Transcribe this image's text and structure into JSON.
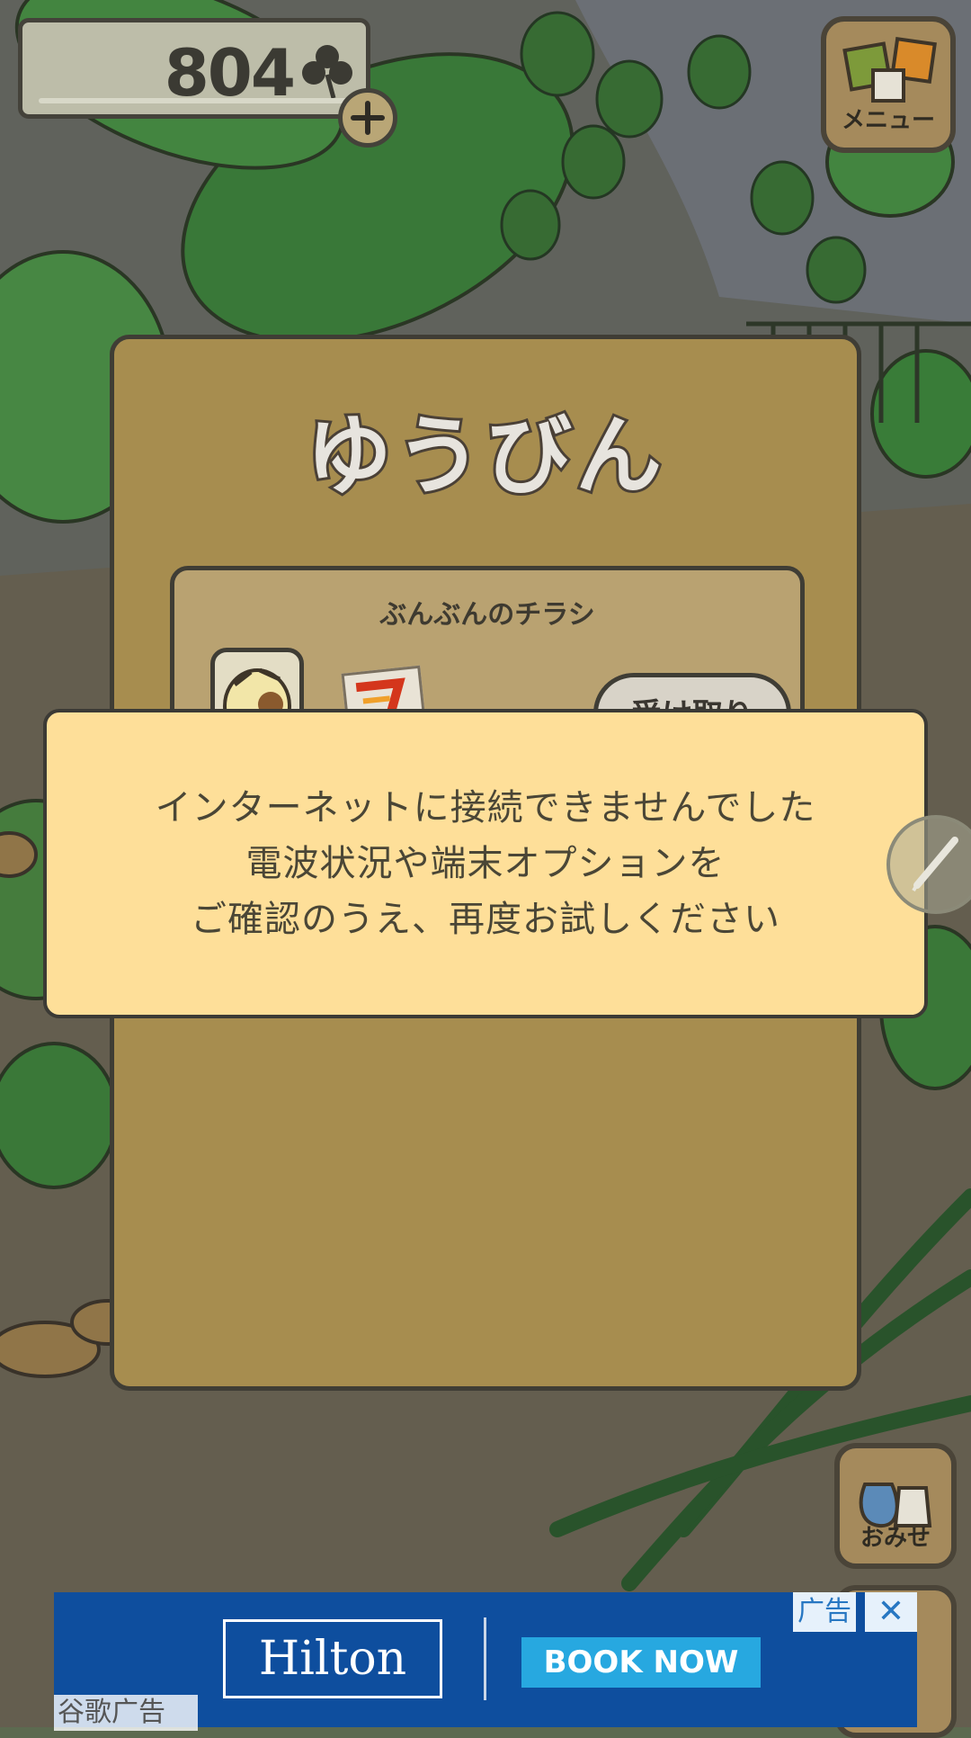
{
  "clovers": {
    "count": "804"
  },
  "menu": {
    "label": "メニュー"
  },
  "mail": {
    "title": "ゆうびん",
    "item": {
      "title": "ぶんぶんのチラシ",
      "receive_label": "受け取り"
    }
  },
  "error_dialog": {
    "lines": [
      "インターネットに接続できませんでした",
      "電波状況や端末オプションを",
      "ご確認のうえ、再度お試しください"
    ]
  },
  "shop": {
    "label": "おみせ"
  },
  "ad": {
    "brand": "Hilton",
    "cta": "BOOK NOW",
    "tag": "广告",
    "close": "✕",
    "label": "谷歌广告"
  }
}
